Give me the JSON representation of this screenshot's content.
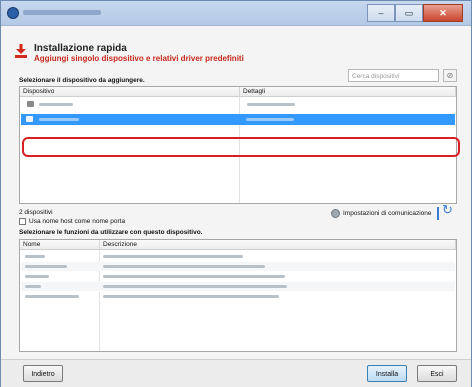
{
  "window": {
    "close_glyph": "✕",
    "minimize_glyph": "–",
    "maximize_glyph": "▭"
  },
  "header": {
    "title": "Installazione rapida",
    "subtitle": "Aggiungi singolo dispositivo e relativi driver predefiniti"
  },
  "search": {
    "placeholder": "Cerca dispositivi"
  },
  "devices": {
    "section_label": "Selezionare il dispositivo da aggiungere.",
    "columns": [
      "Dispositivo",
      "Dettagli"
    ],
    "count_label": "2 dispositivi",
    "hostname_checkbox_label": "Usa nome host come nome porta",
    "comm_settings_label": "Impostazioni di comunicazione"
  },
  "functions": {
    "section_label": "Selezionare le funzioni da utilizzare con questo dispositivo.",
    "columns": [
      "Nome",
      "Descrizione"
    ]
  },
  "buttons": {
    "back": "Indietro",
    "install": "Installa",
    "exit": "Esci"
  },
  "colors": {
    "highlight": "#d91f26",
    "selection": "#3399ff",
    "subtitle": "#c8281c"
  }
}
